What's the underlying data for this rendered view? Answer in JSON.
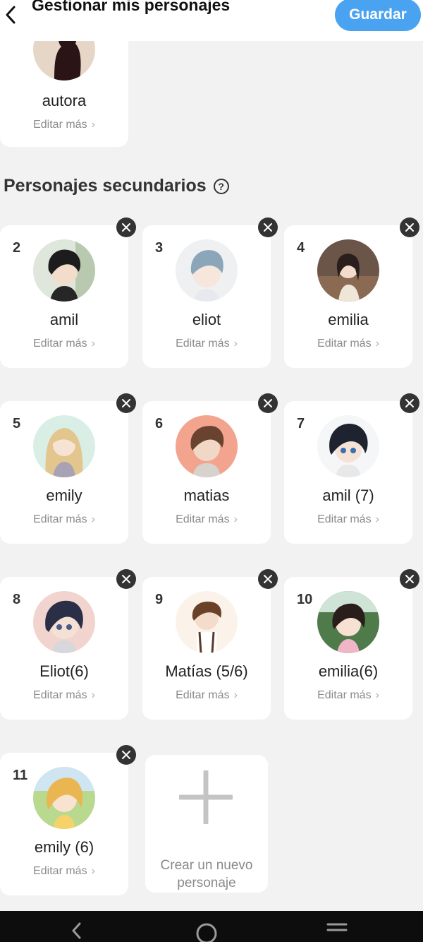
{
  "header": {
    "title": "Gestionar mis personajes",
    "save_label": "Guardar",
    "back_icon": "chevron-left-icon"
  },
  "main_character": {
    "name": "autora",
    "edit_label": "Editar más"
  },
  "section": {
    "title": "Personajes secundarios",
    "help_icon": "question-icon",
    "help_glyph": "?"
  },
  "characters": [
    {
      "number": "2",
      "name": "amil",
      "edit_label": "Editar más"
    },
    {
      "number": "3",
      "name": "eliot",
      "edit_label": "Editar más"
    },
    {
      "number": "4",
      "name": "emilia",
      "edit_label": "Editar más"
    },
    {
      "number": "5",
      "name": "emily",
      "edit_label": "Editar más"
    },
    {
      "number": "6",
      "name": "matias",
      "edit_label": "Editar más"
    },
    {
      "number": "7",
      "name": "amil (7)",
      "edit_label": "Editar más"
    },
    {
      "number": "8",
      "name": "Eliot(6)",
      "edit_label": "Editar más"
    },
    {
      "number": "9",
      "name": "Matías (5/6)",
      "edit_label": "Editar más"
    },
    {
      "number": "10",
      "name": "emilia(6)",
      "edit_label": "Editar más"
    },
    {
      "number": "11",
      "name": "emily (6)",
      "edit_label": "Editar más"
    }
  ],
  "create": {
    "label": "Crear un nuevo personaje"
  },
  "colors": {
    "accent": "#4aa3f0",
    "background": "#f2f2f2",
    "card": "#ffffff",
    "remove_badge": "#333333"
  }
}
